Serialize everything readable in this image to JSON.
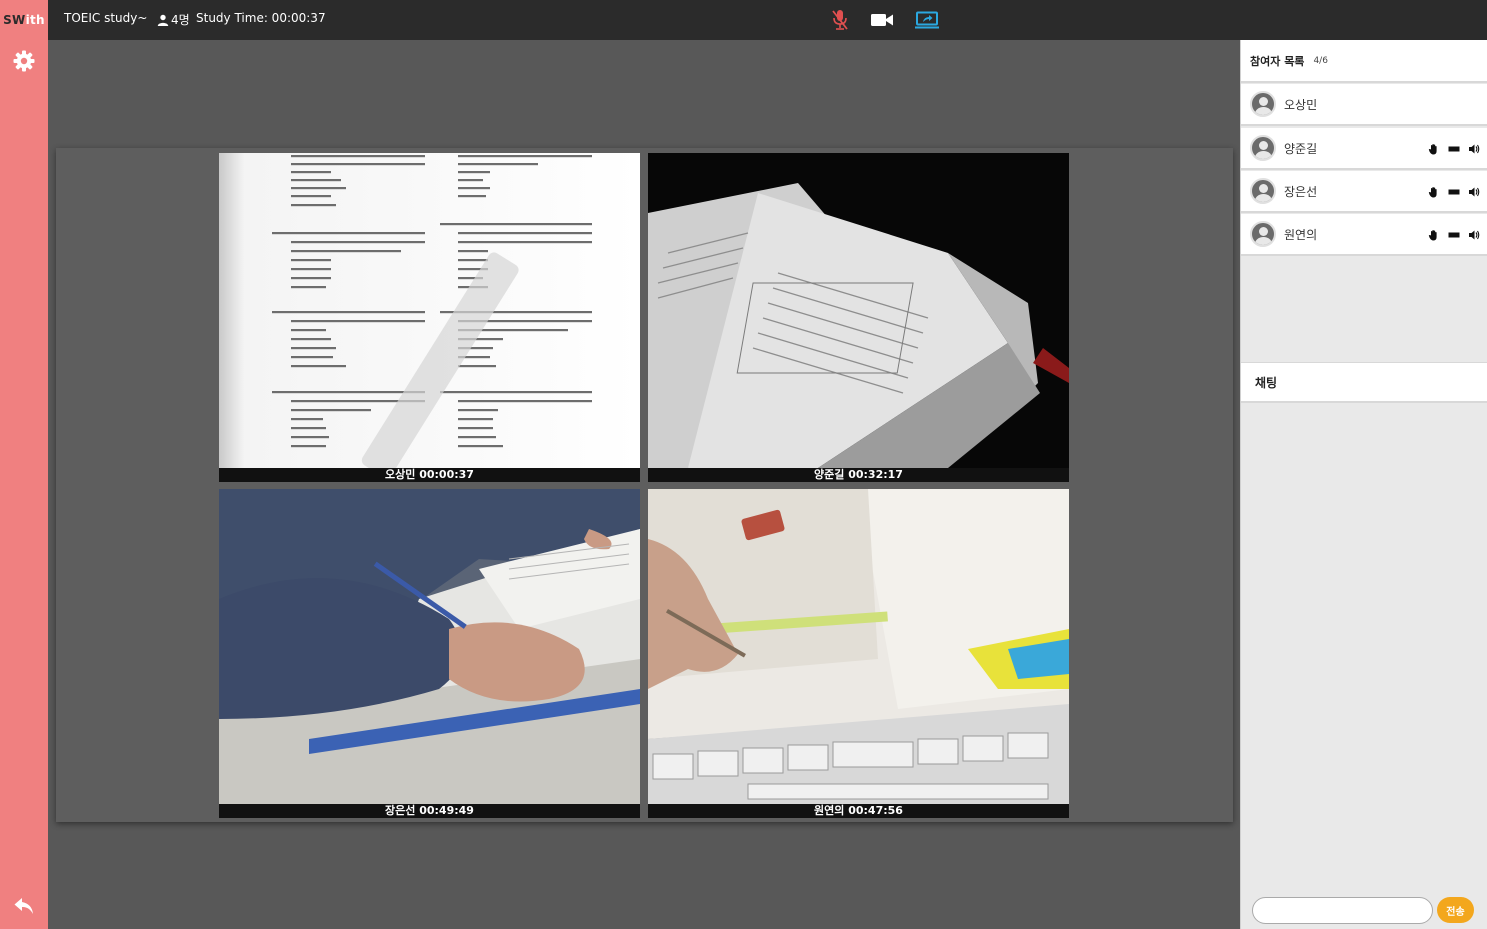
{
  "app": {
    "logo_dark": "SW",
    "logo_light": "ith",
    "room_title": "TOEIC study~",
    "member_count": "4명",
    "study_time": "Study Time: 00:00:37"
  },
  "controls": {
    "mic": {
      "icon": "mic-muted-icon",
      "state": "muted",
      "color": "#e05050"
    },
    "camera": {
      "icon": "video-camera-icon",
      "state": "on",
      "color": "#ffffff"
    },
    "screen_share": {
      "icon": "screen-share-icon",
      "state": "on",
      "color": "#2ba8e0"
    }
  },
  "sidebar": {
    "settings": {
      "icon": "gear-icon"
    },
    "exit": {
      "icon": "back-arrow-icon"
    }
  },
  "video_tiles": [
    {
      "caption": "오상민 00:00:37",
      "feed": "document-screen-share"
    },
    {
      "caption": "양준길 00:32:17",
      "feed": "open-book-camera"
    },
    {
      "caption": "장은선 00:49:49",
      "feed": "writing-camera"
    },
    {
      "caption": "원연의 00:47:56",
      "feed": "book-keyboard-camera"
    }
  ],
  "participants": {
    "title": "참여자 목록",
    "count": "4/6",
    "list": [
      {
        "name": "오상민",
        "show_controls": false
      },
      {
        "name": "양준길",
        "show_controls": true
      },
      {
        "name": "장은선",
        "show_controls": true
      },
      {
        "name": "원연의",
        "show_controls": true
      }
    ],
    "row_icons": [
      "hand-icon",
      "camera-icon",
      "speaker-icon"
    ]
  },
  "chat": {
    "title": "채팅",
    "input_value": "",
    "send_label": "전송"
  },
  "colors": {
    "topbar": "#2b2b2b",
    "sidebar": "#f08080",
    "stage_bg": "#585858",
    "send_button": "#f3a71d"
  }
}
